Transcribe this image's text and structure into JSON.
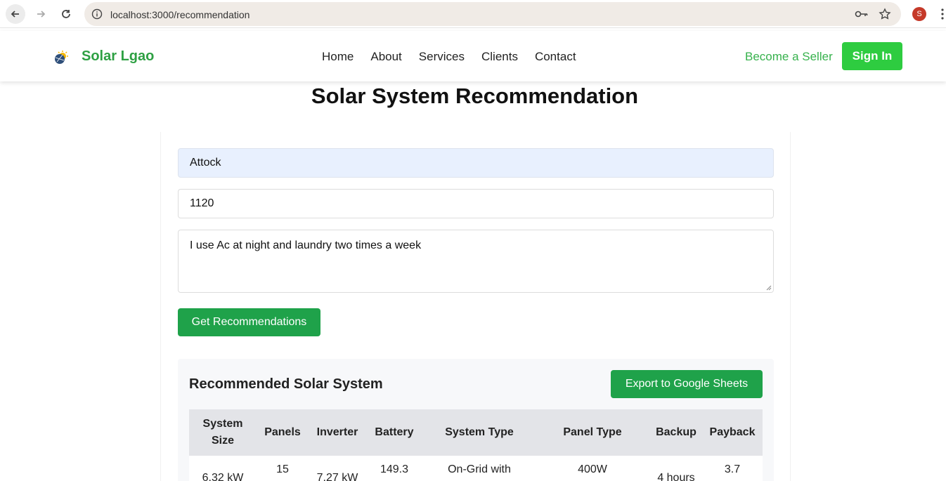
{
  "browser": {
    "url": "localhost:3000/recommendation",
    "profile_initial": "S"
  },
  "site": {
    "brand": "Solar Lgao",
    "nav": [
      "Home",
      "About",
      "Services",
      "Clients",
      "Contact"
    ],
    "seller_link": "Become a Seller",
    "signin": "Sign In"
  },
  "page": {
    "title": "Solar System Recommendation"
  },
  "form": {
    "location": "Attock",
    "units": "1120",
    "usage": "I use Ac at night and laundry two times a week",
    "submit": "Get Recommendations"
  },
  "result": {
    "title": "Recommended Solar System",
    "export": "Export to Google Sheets",
    "headers": [
      "System Size",
      "Panels",
      "Inverter",
      "Battery",
      "System Type",
      "Panel Type",
      "Backup",
      "Payback"
    ],
    "row": {
      "system_size": "6.32 kW",
      "panels": "15",
      "inverter": "7.27 kW",
      "battery": "149.3",
      "system_type": "On-Grid with",
      "panel_type": "400W",
      "backup": "4 hours",
      "payback": "3.7"
    }
  },
  "colors": {
    "brand_green": "#2ea043",
    "button_green": "#1fa24a",
    "signin_green": "#2ecc40"
  }
}
